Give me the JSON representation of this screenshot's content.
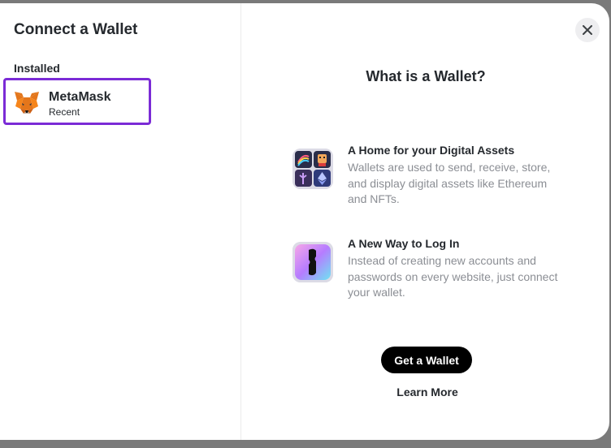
{
  "sidebar": {
    "title": "Connect a Wallet",
    "group_label": "Installed",
    "wallets": [
      {
        "name": "MetaMask",
        "subtitle": "Recent",
        "icon": "metamask-fox-icon"
      }
    ]
  },
  "main": {
    "heading": "What is a Wallet?",
    "features": [
      {
        "title": "A Home for your Digital Assets",
        "description": "Wallets are used to send, receive, store, and display digital assets like Ethereum and NFTs.",
        "icon": "digital-assets-icon"
      },
      {
        "title": "A New Way to Log In",
        "description": "Instead of creating new accounts and passwords on every website, just connect your wallet.",
        "icon": "login-key-icon"
      }
    ],
    "get_wallet_label": "Get a Wallet",
    "learn_more_label": "Learn More"
  },
  "close_icon": "close-icon",
  "colors": {
    "selected_border": "#7b2bd6",
    "button_bg": "#000000",
    "muted_text": "#8b8e94"
  }
}
